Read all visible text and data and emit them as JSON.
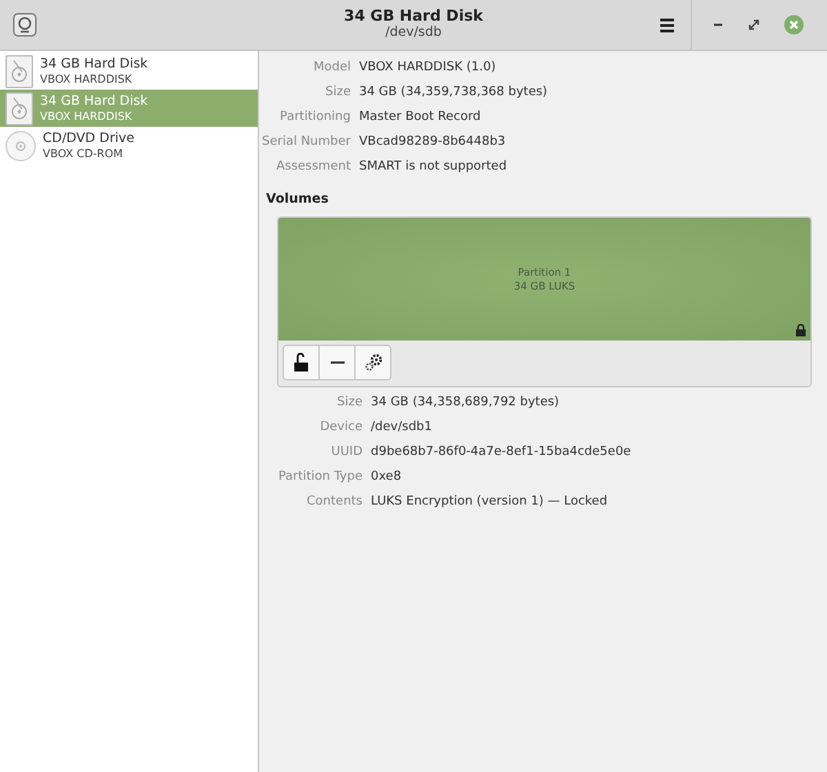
{
  "window": {
    "title": "34 GB Hard Disk",
    "subtitle": "/dev/sdb"
  },
  "sidebar": {
    "items": [
      {
        "kind": "hard-disk",
        "name": "34 GB Hard Disk",
        "model": "VBOX HARDDISK",
        "selected": false
      },
      {
        "kind": "hard-disk",
        "name": "34 GB Hard Disk",
        "model": "VBOX HARDDISK",
        "selected": true
      },
      {
        "kind": "optical",
        "name": "CD/DVD Drive",
        "model": "VBOX CD-ROM",
        "selected": false
      }
    ]
  },
  "disk_properties": [
    {
      "label": "Model",
      "value": "VBOX HARDDISK (1.0)"
    },
    {
      "label": "Size",
      "value": "34 GB (34,359,738,368 bytes)"
    },
    {
      "label": "Partitioning",
      "value": "Master Boot Record"
    },
    {
      "label": "Serial Number",
      "value": "VBcad98289-8b6448b3"
    },
    {
      "label": "Assessment",
      "value": "SMART is not supported"
    }
  ],
  "volumes": {
    "heading": "Volumes",
    "partitions": [
      {
        "name": "Partition 1",
        "detail": "34 GB LUKS",
        "selected": true,
        "locked": true
      }
    ],
    "toolbar": [
      {
        "kind": "unlock"
      },
      {
        "kind": "remove"
      },
      {
        "kind": "settings"
      }
    ]
  },
  "volume_properties": [
    {
      "label": "Size",
      "value": "34 GB (34,358,689,792 bytes)"
    },
    {
      "label": "Device",
      "value": "/dev/sdb1"
    },
    {
      "label": "UUID",
      "value": "d9be68b7-86f0-4a7e-8ef1-15ba4cde5e0e"
    },
    {
      "label": "Partition Type",
      "value": "0xe8"
    },
    {
      "label": "Contents",
      "value": "LUKS Encryption (version 1) — Locked"
    }
  ]
}
